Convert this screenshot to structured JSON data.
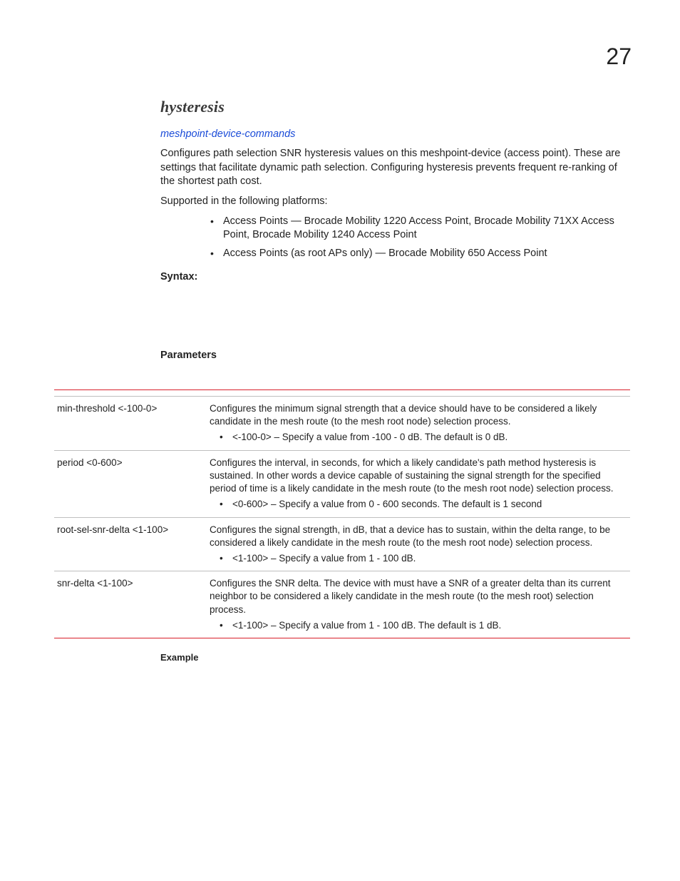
{
  "pageNumber": "27",
  "section": {
    "title": "hysteresis",
    "breadcrumb": "meshpoint-device-commands",
    "intro": "Configures path selection SNR hysteresis values on this meshpoint-device (access point). These are settings that facilitate dynamic path selection. Configuring hysteresis prevents frequent re-ranking of the shortest path cost.",
    "platformsLead": "Supported in the following platforms:",
    "platforms": [
      "Access Points — Brocade Mobility 1220 Access Point, Brocade Mobility 71XX Access Point, Brocade Mobility 1240 Access Point",
      "Access Points (as root APs only) — Brocade Mobility 650 Access Point"
    ],
    "syntaxLabel": "Syntax:",
    "parametersLabel": "Parameters",
    "exampleLabel": "Example"
  },
  "paramsTable": [
    {
      "name": "min-threshold <-100-0>",
      "desc": "Configures the minimum signal strength that a device should have to be considered a likely candidate in the mesh route (to the mesh root node) selection process.",
      "bullet": "<-100-0> – Specify a value from -100 - 0 dB. The default is 0 dB."
    },
    {
      "name": "period <0-600>",
      "desc": "Configures the interval, in seconds, for which a likely candidate's path method hysteresis is sustained. In other words a device capable of sustaining the signal strength for the specified period of time is a likely candidate in the mesh route (to the mesh root node) selection process.",
      "bullet": "<0-600> – Specify a value from 0 - 600 seconds. The default is 1 second"
    },
    {
      "name": "root-sel-snr-delta <1-100>",
      "desc": "Configures the signal strength, in dB, that a device has to sustain, within the delta range, to be considered a likely candidate in the mesh route (to the mesh root node) selection process.",
      "bullet": "<1-100> – Specify a value from 1 - 100 dB."
    },
    {
      "name": "snr-delta <1-100>",
      "desc": "Configures the SNR delta. The device with must have a SNR of a greater delta than its current neighbor to be considered a likely candidate in the mesh route (to the mesh root) selection process.",
      "bullet": "<1-100> – Specify a value from 1 - 100 dB. The default is 1 dB."
    }
  ]
}
